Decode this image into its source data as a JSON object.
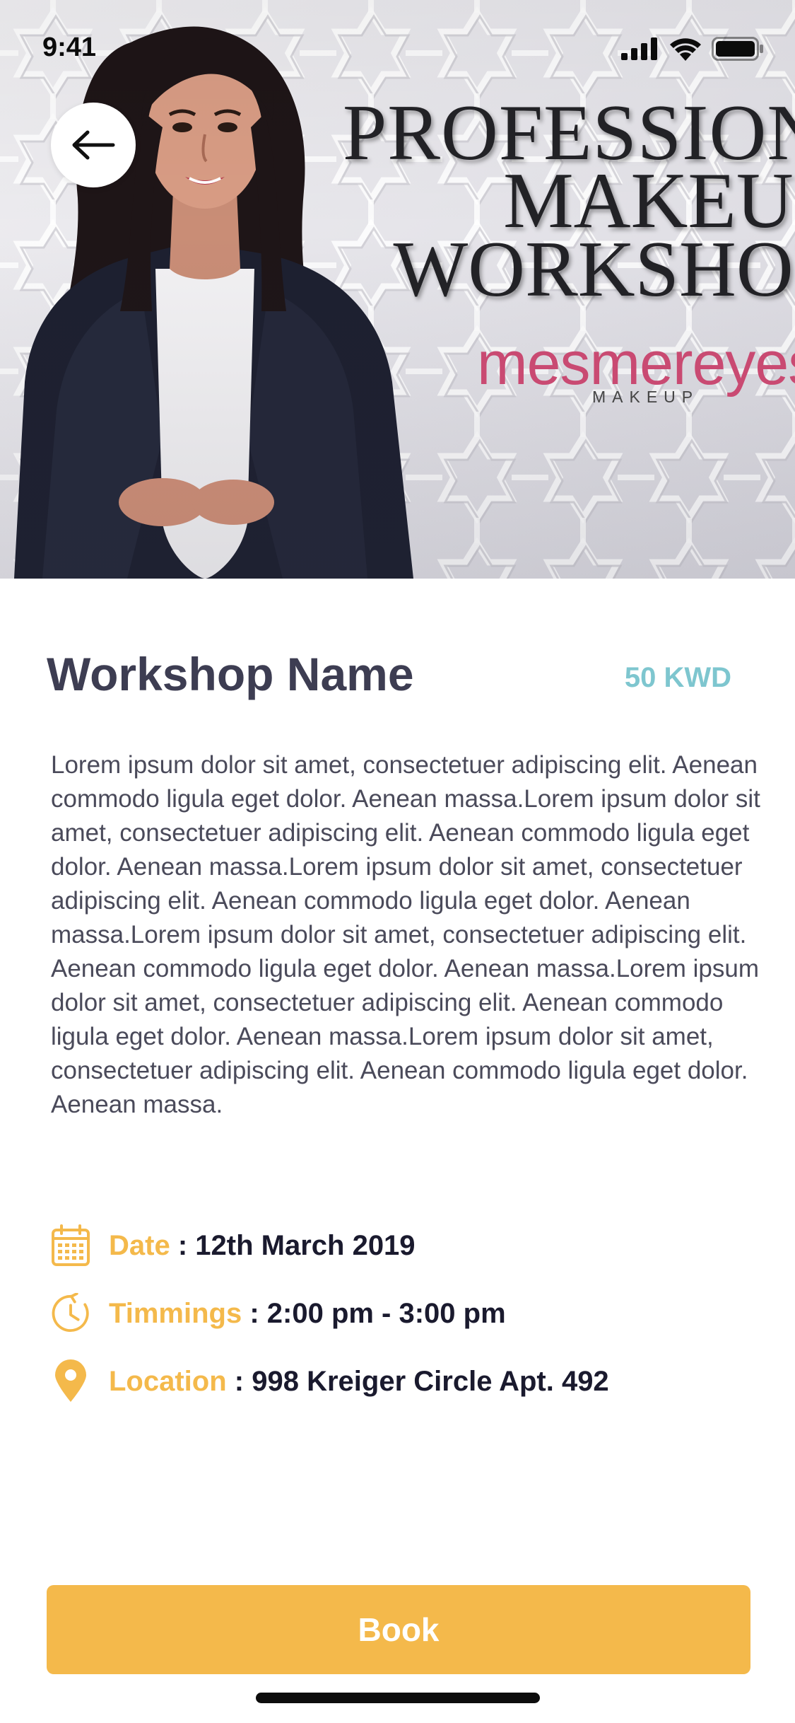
{
  "status_bar": {
    "time": "9:41"
  },
  "banner": {
    "title_line1": "PROFESSIONAL",
    "title_line2": "MAKEUP",
    "title_line3": "WORKSHOP",
    "brand": "mesmereyes",
    "brand_sub": "MAKEUP",
    "brand_color": "#c94a72"
  },
  "workshop": {
    "name": "Workshop Name",
    "price": "50 KWD",
    "description": "Lorem ipsum dolor sit amet, consectetuer adipiscing elit. Aenean commodo ligula eget dolor. Aenean massa.Lorem ipsum dolor sit amet, consectetuer adipiscing elit. Aenean commodo ligula eget dolor. Aenean massa.Lorem ipsum dolor sit amet, consectetuer adipiscing elit. Aenean commodo ligula eget dolor. Aenean massa.Lorem ipsum dolor sit amet, consectetuer adipiscing elit. Aenean commodo ligula eget dolor. Aenean massa.Lorem ipsum dolor sit amet, consectetuer adipiscing elit. Aenean commodo ligula eget dolor. Aenean massa.Lorem ipsum dolor sit amet, consectetuer adipiscing elit. Aenean commodo ligula eget dolor. Aenean massa."
  },
  "details": {
    "separator": ":",
    "date_label": "Date",
    "date_value": "12th March 2019",
    "timings_label": "Timmings",
    "timings_value": "2:00 pm - 3:00 pm",
    "location_label": "Location",
    "location_value": "998 Kreiger Circle Apt. 492",
    "icons": [
      "calendar-icon",
      "clock-icon",
      "location-pin-icon"
    ]
  },
  "actions": {
    "book_label": "Book"
  },
  "colors": {
    "accent": "#f4b94b",
    "price": "#7ec6cf",
    "title": "#3d3d52",
    "value_text": "#1a1a2e"
  }
}
